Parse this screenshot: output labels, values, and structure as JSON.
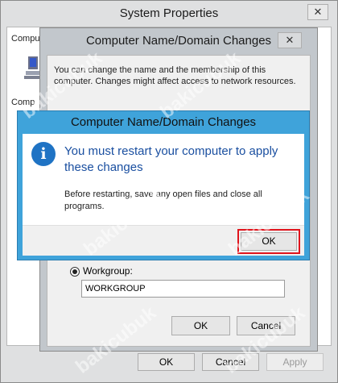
{
  "system_properties": {
    "title": "System Properties",
    "close_glyph": "✕",
    "tab_text_partial": "Compu",
    "computer_text_partial": "Comp",
    "ok_label": "OK",
    "cancel_label": "Cancel",
    "apply_label": "Apply"
  },
  "name_change_dialog": {
    "title": "Computer Name/Domain Changes",
    "close_glyph": "✕",
    "description": "You can change the name and the membership of this computer. Changes might affect access to network resources.",
    "workgroup_radio_label": "Workgroup:",
    "workgroup_selected": true,
    "workgroup_value": "WORKGROUP",
    "ok_label": "OK",
    "cancel_label": "Cancel"
  },
  "restart_dialog": {
    "title": "Computer Name/Domain Changes",
    "info_glyph": "i",
    "heading": "You must restart your computer to apply these changes",
    "message": "Before restarting, save any open files and close all programs.",
    "ok_label": "OK",
    "highlight_color": "#e0141c"
  },
  "watermark": {
    "text": "bakicubuk"
  },
  "colors": {
    "accent_title": "#3fa3da",
    "heading_blue": "#1a4fa0",
    "info_icon": "#1f73c4"
  }
}
